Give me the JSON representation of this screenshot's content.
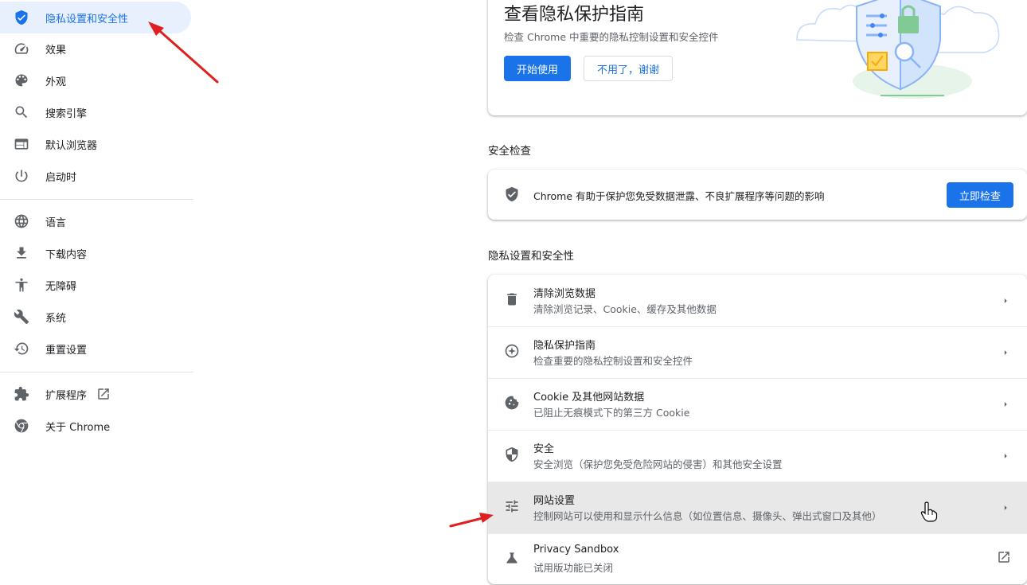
{
  "sidebar": {
    "items": [
      {
        "label": "隐私设置和安全性",
        "icon": "shield-icon",
        "active": true
      },
      {
        "label": "效果",
        "icon": "speedometer-icon"
      },
      {
        "label": "外观",
        "icon": "palette-icon"
      },
      {
        "label": "搜索引擎",
        "icon": "search-icon"
      },
      {
        "label": "默认浏览器",
        "icon": "browser-window-icon"
      },
      {
        "label": "启动时",
        "icon": "power-icon"
      },
      {
        "label": "语言",
        "icon": "globe-icon"
      },
      {
        "label": "下载内容",
        "icon": "download-icon"
      },
      {
        "label": "无障碍",
        "icon": "accessibility-icon"
      },
      {
        "label": "系统",
        "icon": "wrench-icon"
      },
      {
        "label": "重置设置",
        "icon": "history-icon"
      },
      {
        "label": "扩展程序",
        "icon": "puzzle-icon"
      },
      {
        "label": "关于 Chrome",
        "icon": "chrome-icon"
      }
    ]
  },
  "promo": {
    "title": "查看隐私保护指南",
    "description": "检查 Chrome 中重要的隐私控制设置和安全控件",
    "start_label": "开始使用",
    "dismiss_label": "不用了，谢谢"
  },
  "safety_check": {
    "section_title": "安全检查",
    "description": "Chrome 有助于保护您免受数据泄露、不良扩展程序等问题的影响",
    "button_label": "立即检查"
  },
  "privacy": {
    "section_title": "隐私设置和安全性",
    "rows": [
      {
        "title": "清除浏览数据",
        "subtitle": "清除浏览记录、Cookie、缓存及其他数据",
        "icon": "trash-icon"
      },
      {
        "title": "隐私保护指南",
        "subtitle": "检查重要的隐私控制设置和安全控件",
        "icon": "compass-icon"
      },
      {
        "title": "Cookie 及其他网站数据",
        "subtitle": "已阻止无痕模式下的第三方 Cookie",
        "icon": "cookie-icon"
      },
      {
        "title": "安全",
        "subtitle": "安全浏览（保护您免受危险网站的侵害）和其他安全设置",
        "icon": "shield-icon"
      },
      {
        "title": "网站设置",
        "subtitle": "控制网站可以使用和显示什么信息（如位置信息、摄像头、弹出式窗口及其他）",
        "icon": "tune-icon"
      },
      {
        "title": "Privacy Sandbox",
        "subtitle": "试用版功能已关闭",
        "icon": "flask-icon"
      }
    ]
  },
  "colors": {
    "accent": "#1a73e8",
    "active_bg": "#e8f0fe",
    "annotation_arrow": "#e02020",
    "hover_row": "#e8e8e8"
  }
}
